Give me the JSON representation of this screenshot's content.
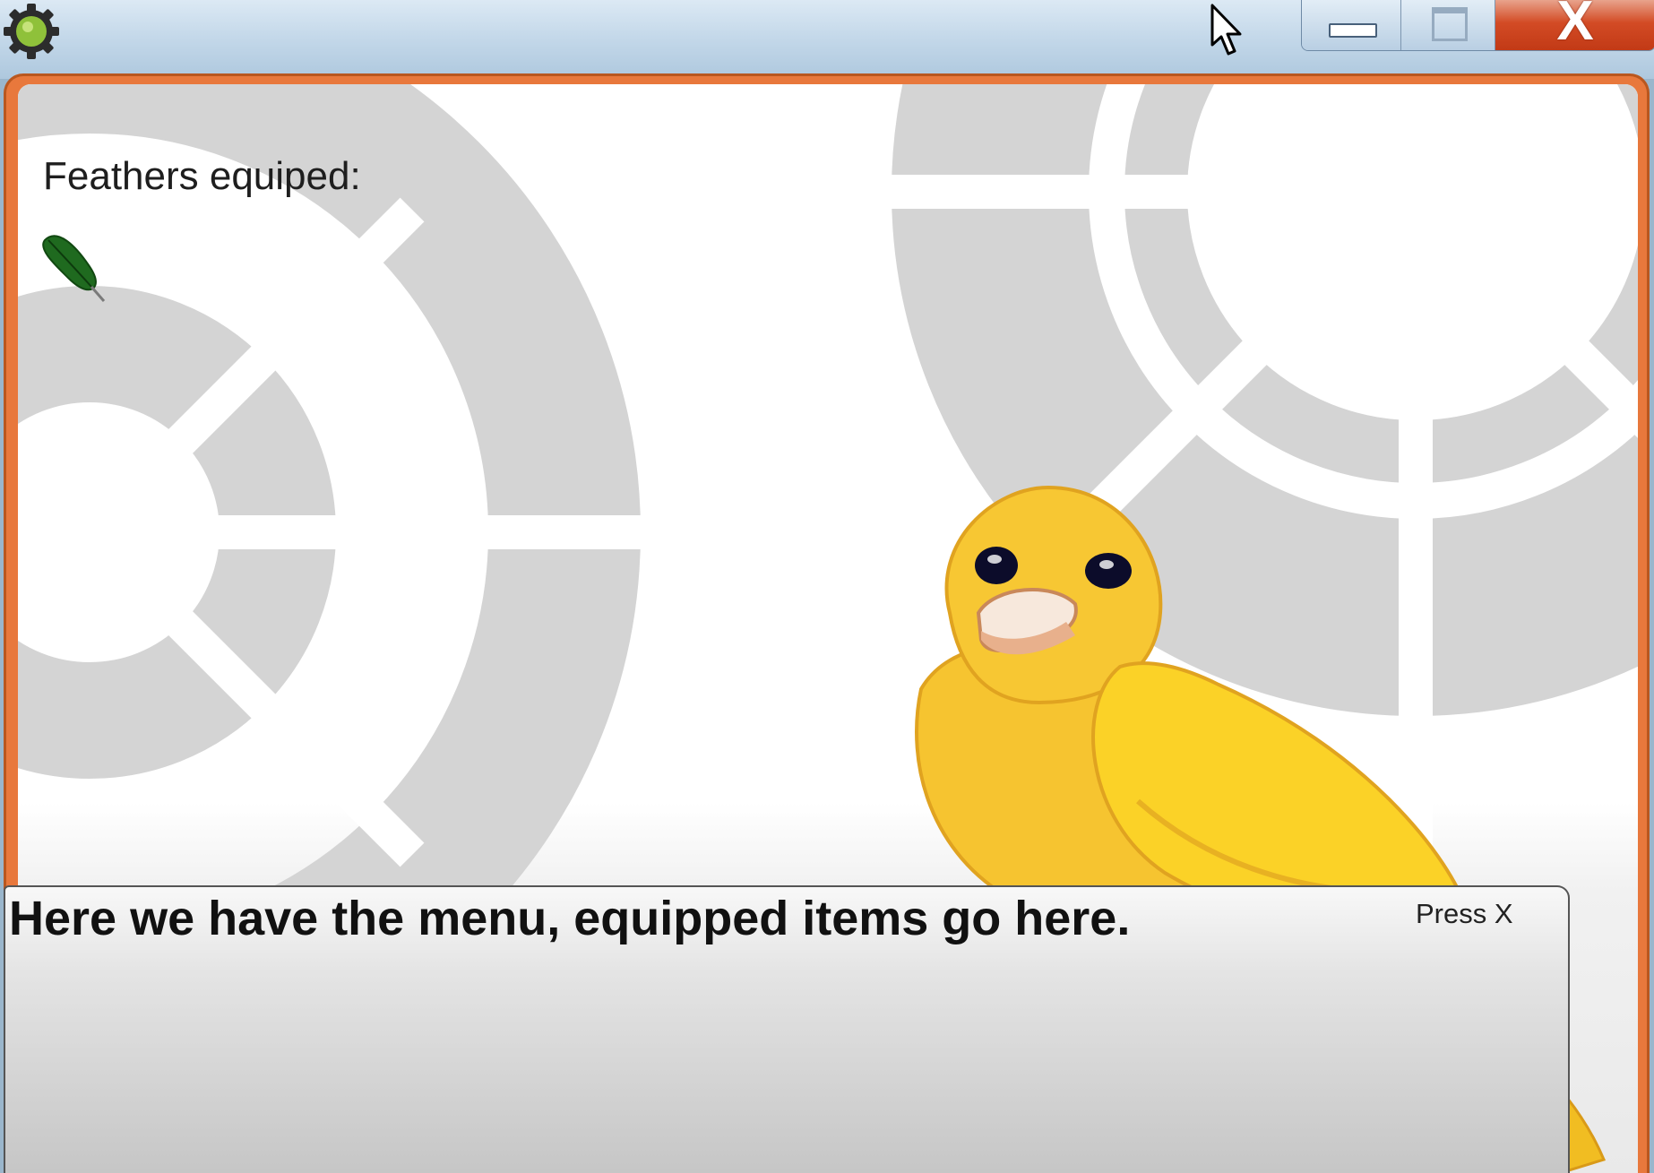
{
  "window": {
    "app_icon": "gear-icon",
    "controls": {
      "minimize": "minimize-icon",
      "maximize": "maximize-icon",
      "close_label": "X"
    },
    "pointer": "cursor-icon"
  },
  "hud": {
    "feathers_label": "Feathers equiped:",
    "equipped_items": [
      {
        "icon": "feather-icon",
        "color": "#1f6a1f"
      }
    ]
  },
  "dialog": {
    "message": "Here we have the menu, equipped items go here.",
    "prompt": "Press X"
  },
  "colors": {
    "frame": "#e8783c",
    "bird_body": "#f6c430",
    "background_rings": "#d4d4d4"
  }
}
